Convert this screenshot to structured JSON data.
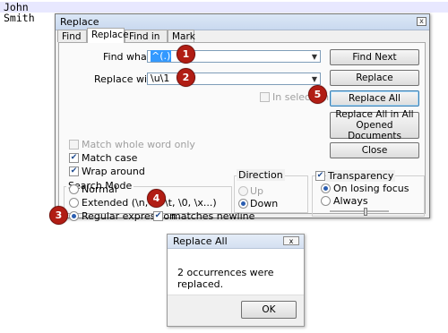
{
  "editor": {
    "lines": [
      "John",
      "Smith"
    ]
  },
  "dialog": {
    "title": "Replace",
    "close_glyph": "x",
    "tabs": [
      "Find",
      "Replace",
      "Find in Files",
      "Mark"
    ],
    "find_label": "Find what :",
    "find_value": "^(.)",
    "replace_label": "Replace with :",
    "replace_value": "\\u\\1",
    "in_selection": "In selection",
    "buttons": {
      "find_next": "Find Next",
      "replace": "Replace",
      "replace_all": "Replace All",
      "replace_all_opened_line1": "Replace All in All Opened",
      "replace_all_opened_line2": "Documents",
      "close": "Close"
    },
    "options": {
      "match_whole_word": {
        "label": "Match whole word only",
        "checked": false,
        "disabled": true
      },
      "match_case": {
        "label": "Match case",
        "checked": true
      },
      "wrap_around": {
        "label": "Wrap around",
        "checked": true
      }
    },
    "search_mode": {
      "title": "Search Mode",
      "normal": "Normal",
      "extended": "Extended (\\n, \\r, \\t, \\0, \\x...)",
      "regex": "Regular expression",
      "matches_newline": ". matches newline",
      "selected": "regex"
    },
    "direction": {
      "title": "Direction",
      "up": "Up",
      "down": "Down",
      "selected": "down"
    },
    "transparency": {
      "title": "Transparency",
      "checked": true,
      "on_losing_focus": "On losing focus",
      "always": "Always",
      "selected": "on_losing_focus",
      "slider_fraction": 0.6
    }
  },
  "badges": [
    "1",
    "2",
    "3",
    "4",
    "5"
  ],
  "message_box": {
    "title": "Replace All",
    "text": "2 occurrences were replaced.",
    "ok": "OK",
    "close_glyph": "x"
  },
  "colors": {
    "badge": "#b11d14",
    "selection": "#3399ff",
    "checkmark": "#1f4b8f"
  }
}
